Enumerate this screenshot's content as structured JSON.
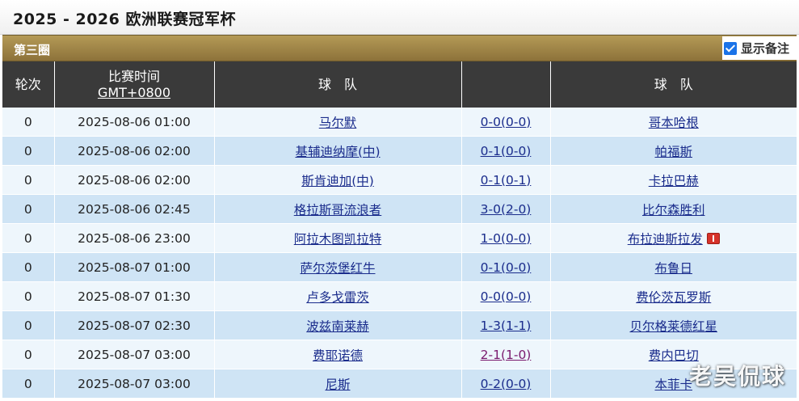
{
  "page_title": "2025 - 2026 欧洲联赛冠军杯",
  "round_label": "第三圈",
  "show_notes": {
    "label": "显示备注",
    "checked": true
  },
  "headers": {
    "round": "轮次",
    "time_line1": "比赛时间",
    "time_line2": "GMT+0800",
    "home_team": "球　队",
    "score": "",
    "away_team": "球　队"
  },
  "matches": [
    {
      "round": "0",
      "time": "2025-08-06 01:00",
      "home": "马尔默",
      "score": "0-0(0-0)",
      "away": "哥本哈根"
    },
    {
      "round": "0",
      "time": "2025-08-06 02:00",
      "home": "基辅迪纳摩(中)",
      "score": "0-1(0-0)",
      "away": "帕福斯"
    },
    {
      "round": "0",
      "time": "2025-08-06 02:00",
      "home": "斯肯迪加(中)",
      "score": "0-1(0-1)",
      "away": "卡拉巴赫"
    },
    {
      "round": "0",
      "time": "2025-08-06 02:45",
      "home": "格拉斯哥流浪者",
      "score": "3-0(2-0)",
      "away": "比尔森胜利"
    },
    {
      "round": "0",
      "time": "2025-08-06 23:00",
      "home": "阿拉木图凯拉特",
      "score": "1-0(0-0)",
      "away": "布拉迪斯拉发"
    },
    {
      "round": "0",
      "time": "2025-08-07 01:00",
      "home": "萨尔茨堡红牛",
      "score": "0-1(0-0)",
      "away": "布鲁日"
    },
    {
      "round": "0",
      "time": "2025-08-07 01:30",
      "home": "卢多戈雷茨",
      "score": "0-0(0-0)",
      "away": "费伦茨瓦罗斯"
    },
    {
      "round": "0",
      "time": "2025-08-07 02:30",
      "home": "波兹南莱赫",
      "score": "1-3(1-1)",
      "away": "贝尔格莱德红星"
    },
    {
      "round": "0",
      "time": "2025-08-07 03:00",
      "home": "费耶诺德",
      "score": "2-1(1-0)",
      "away": "费内巴切"
    },
    {
      "round": "0",
      "time": "2025-08-07 03:00",
      "home": "尼斯",
      "score": "0-2(0-0)",
      "away": "本菲卡"
    }
  ],
  "watermark": "老吴侃球",
  "colors": {
    "header_bg": "#3a3a3a",
    "round_bar": "#9b8045",
    "row_light": "#eef6fc",
    "row_dark": "#cfe4f5",
    "link": "#1a2c8c",
    "visited_link": "#7a1a6e"
  }
}
